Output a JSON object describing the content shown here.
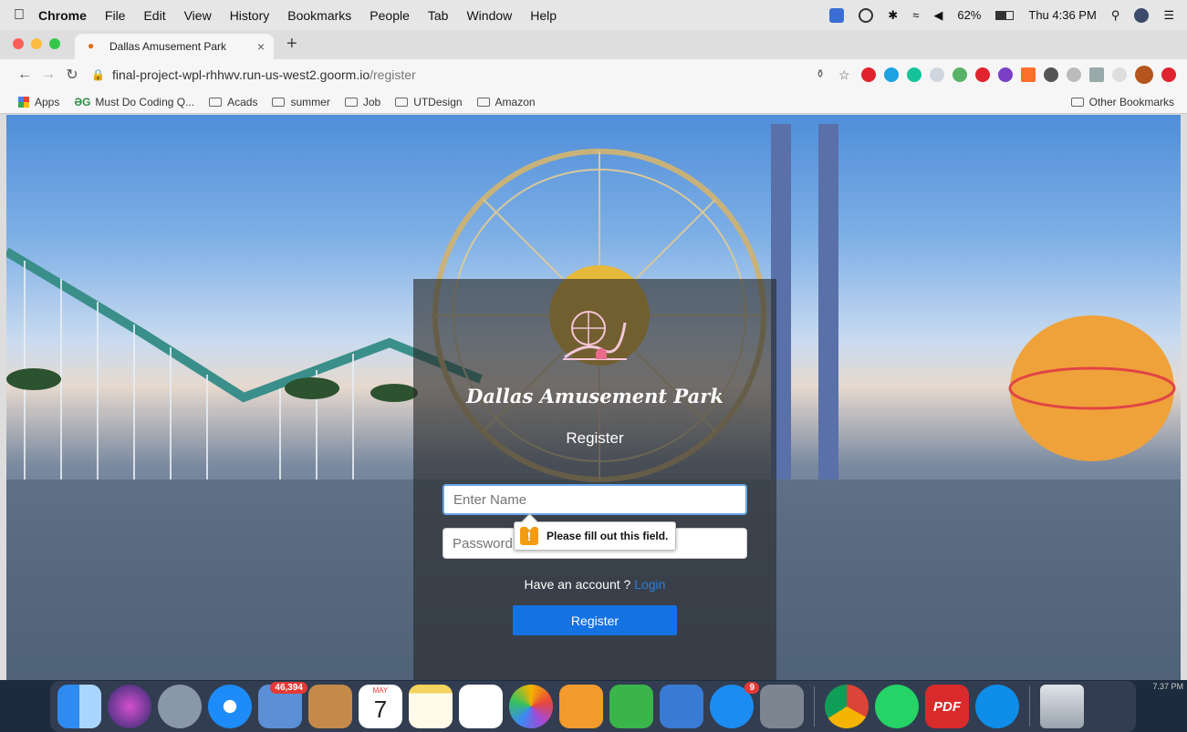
{
  "menubar": {
    "app": "Chrome",
    "items": [
      "File",
      "Edit",
      "View",
      "History",
      "Bookmarks",
      "People",
      "Tab",
      "Window",
      "Help"
    ],
    "battery": "62%",
    "clock": "Thu 4:36 PM"
  },
  "tab": {
    "title": "Dallas Amusement Park",
    "close": "×",
    "new_tab": "+"
  },
  "address": {
    "host": "final-project-wpl-rhhwv.run-us-west2.goorm.io",
    "path": "/register"
  },
  "bookmarks": {
    "apps": "Apps",
    "items": [
      "Must Do Coding Q...",
      "Acads",
      "summer",
      "Job",
      "UTDesign",
      "Amazon"
    ],
    "other": "Other Bookmarks"
  },
  "page": {
    "site_title": "Dallas Amusement Park",
    "form_title": "Register",
    "name_placeholder": "Enter Name",
    "password_placeholder": "Password",
    "validation_message": "Please fill out this field.",
    "account_prompt": "Have an account ?",
    "login_link": "Login",
    "register_button": "Register"
  },
  "dock": {
    "mail_badge": "46,394",
    "calendar_month": "MAY",
    "calendar_day": "7",
    "appstore_badge": "9",
    "pdf_label": "PDF",
    "corner_time": "7.37 PM"
  }
}
